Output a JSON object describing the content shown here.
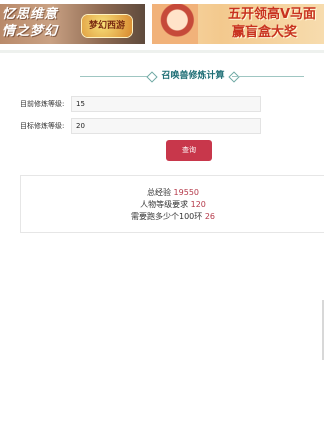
{
  "banner": {
    "left_slogan_line1": "忆思维意",
    "left_slogan_line2": "情之梦幻",
    "left_logo_text": "梦幻西游",
    "right_promo_line1": "五开领高V马面",
    "right_promo_line2": "赢盲盒大奖"
  },
  "page_title": "召唤兽修炼计算",
  "form": {
    "current_level_label": "目前修炼等级:",
    "current_level_value": "15",
    "target_level_label": "目标修炼等级:",
    "target_level_value": "20",
    "query_button_label": "查询"
  },
  "result": {
    "total_exp_label": "总经验",
    "total_exp_value": "19550",
    "char_level_label": "人物等级要求",
    "char_level_value": "120",
    "rings_label": "需要跑多少个100环",
    "rings_value": "26"
  },
  "colors": {
    "title": "#1f6f76",
    "accent_button": "#c8374b",
    "result_value": "#b53a4a"
  }
}
